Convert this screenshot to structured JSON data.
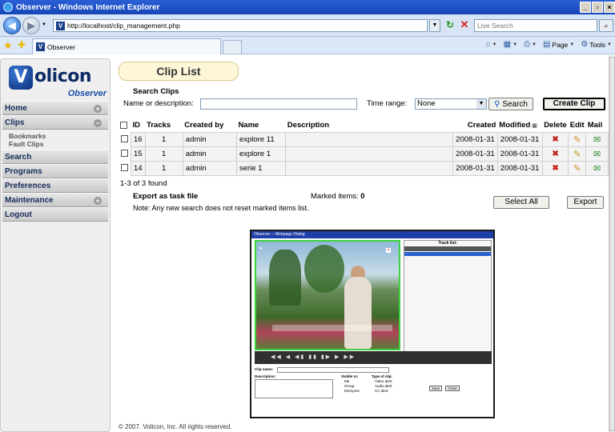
{
  "browser": {
    "window_title": "Observer - Windows Internet Explorer",
    "url": "http://localhost/clip_management.php",
    "search_placeholder": "Live Search",
    "tab_title": "Observer",
    "commands": {
      "page": "Page",
      "tools": "Tools"
    }
  },
  "sidebar": {
    "logo_text": "olicon",
    "logo_letter": "V",
    "logo_sub": "Observer",
    "menu": [
      {
        "label": "Home",
        "expander": "+"
      },
      {
        "label": "Clips",
        "expander": "−"
      },
      {
        "label": "Search"
      },
      {
        "label": "Programs"
      },
      {
        "label": "Preferences"
      },
      {
        "label": "Maintenance",
        "expander": "+"
      },
      {
        "label": "Logout"
      }
    ],
    "clips_sub": [
      "Bookmarks",
      "Fault Clips"
    ]
  },
  "main": {
    "title": "Clip List",
    "search": {
      "heading": "Search Clips",
      "name_label": "Name or description:",
      "name_value": "",
      "time_label": "Time range:",
      "time_value": "None",
      "search_button": "Search",
      "create_button": "Create Clip"
    },
    "table": {
      "headers": [
        "ID",
        "Tracks",
        "Created by",
        "Name",
        "Description",
        "Created",
        "Modified",
        "Delete",
        "Edit",
        "Mail"
      ],
      "rows": [
        {
          "id": "16",
          "tracks": "1",
          "created_by": "admin",
          "name": "explore 11",
          "description": "",
          "created": "2008-01-31",
          "modified": "2008-01-31"
        },
        {
          "id": "15",
          "tracks": "1",
          "created_by": "admin",
          "name": "explore 1",
          "description": "",
          "created": "2008-01-31",
          "modified": "2008-01-31"
        },
        {
          "id": "14",
          "tracks": "1",
          "created_by": "admin",
          "name": "serie 1",
          "description": "",
          "created": "2008-01-31",
          "modified": "2008-01-31"
        }
      ]
    },
    "found_text": "1-3 of 3 found",
    "export": {
      "heading": "Export as task file",
      "marked_label": "Marked items:",
      "marked_count": "0",
      "note": "Note: Any new search does not reset marked items list.",
      "select_all_button": "Select All",
      "export_button": "Export"
    },
    "footer": "© 2007. Volicon, Inc. All rights reserved."
  },
  "screenshot_dialog": {
    "title": "Observer -- Webpage Dialog",
    "track_list": "Track list:",
    "clip_name_label": "Clip name:",
    "description_label": "Description:",
    "visible_to_label": "Visible to:",
    "type_label": "Type of clip:",
    "visible_options": [
      "Me",
      "Group",
      "Everyone"
    ],
    "type_options": [
      "Video alert",
      "Audio alert",
      "CC alert"
    ],
    "save": "Save",
    "close": "Close"
  }
}
